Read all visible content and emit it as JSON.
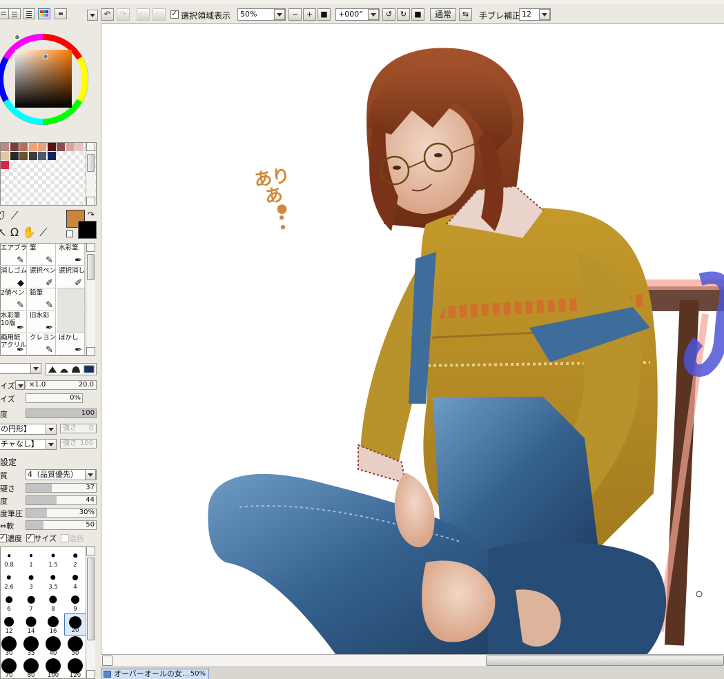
{
  "toolbar": {
    "show_selection_label": "選択領域表示",
    "zoom_value": "50%",
    "rotation_value": "+000°",
    "blend_mode_label": "通常",
    "stabilizer_label": "手ブレ補正",
    "stabilizer_value": "12"
  },
  "palette": {
    "swatch_colors_row1": [
      "#b68a8a",
      "#7a3c3c",
      "#b56f62",
      "#f0a27a",
      "#e8a27b",
      "#5a1313",
      "#8a5050",
      "#d6a7a2",
      "#e9c3c3",
      "#ffe4e4"
    ],
    "swatch_colors_row2": [
      "#e0c9a0",
      "#2a2a2a",
      "#6b5330",
      "#3d3d3d",
      "#4a5b6c",
      "#112266"
    ],
    "swatch_colors_row3": [
      "#e0244a"
    ],
    "main_color": "#c8873a",
    "sub_color": "#000000"
  },
  "brushes": [
    {
      "label": "エアブラシ",
      "icon": "airbrush-icon"
    },
    {
      "label": "筆",
      "icon": "brush-icon"
    },
    {
      "label": "水彩筆",
      "icon": "watercolor-icon"
    },
    {
      "label": "消しゴム",
      "icon": "eraser-icon"
    },
    {
      "label": "選択ペン",
      "icon": "selection-pen-icon"
    },
    {
      "label": "選択消し",
      "icon": "selection-erase-icon"
    },
    {
      "label": "2値ペン",
      "icon": "binary-pen-icon"
    },
    {
      "label": "鉛筆",
      "icon": "pencil-icon"
    },
    {
      "label": "",
      "icon": ""
    },
    {
      "label": "水彩筆",
      "label2": "10版",
      "icon": "watercolor-icon"
    },
    {
      "label": "旧水彩",
      "icon": "old-watercolor-icon"
    },
    {
      "label": "",
      "icon": ""
    },
    {
      "label": "画用紙",
      "label2": "アクリル",
      "icon": "paper-icon"
    },
    {
      "label": "クレヨン",
      "icon": "crayon-icon"
    },
    {
      "label": "ぼかし",
      "icon": "blur-icon"
    }
  ],
  "brush_settings": {
    "size_label": "イズ",
    "size_multiplier": "×1.0",
    "size_value": "20.0",
    "min_size_label": "イズ",
    "min_size_value": "0%",
    "density_label": "度",
    "density_value": "100",
    "density_fill": 1.0,
    "shape_combo": "の円形】",
    "shape_strength_label": "強さ",
    "shape_strength_value": "0",
    "texture_combo": "チャなし】",
    "texture_strength_label": "強さ",
    "texture_strength_value": "100",
    "advanced_label": "設定",
    "quality_label": "質",
    "quality_combo": "4（品質優先）",
    "hardness_label": "硬さ",
    "hardness_value": "37",
    "hardness_fill": 0.37,
    "min_density_label": "度",
    "min_density_value": "44",
    "min_density_fill": 0.44,
    "max_pressure_label": "度筆圧",
    "max_pressure_value": "30%",
    "max_pressure_fill": 0.3,
    "hard_soft_label": "⇔軟",
    "hard_soft_value": "50",
    "hard_soft_fill": 0.25,
    "check_density": "濃度",
    "check_size": "サイズ",
    "check_mix": "混色"
  },
  "brush_sizes": [
    "0.8",
    "1",
    "1.5",
    "2",
    "2.6",
    "3",
    "3.5",
    "4",
    "6",
    "7",
    "8",
    "9",
    "12",
    "14",
    "16",
    "20",
    "30",
    "35",
    "40",
    "50",
    "70",
    "80",
    "100",
    "120"
  ],
  "selected_size": "20",
  "document": {
    "tab_title": "オーバーオールの女...",
    "tab_zoom": "50%"
  },
  "canvas_text": {
    "handwritten_1": "あり",
    "handwritten_2": "あ"
  }
}
